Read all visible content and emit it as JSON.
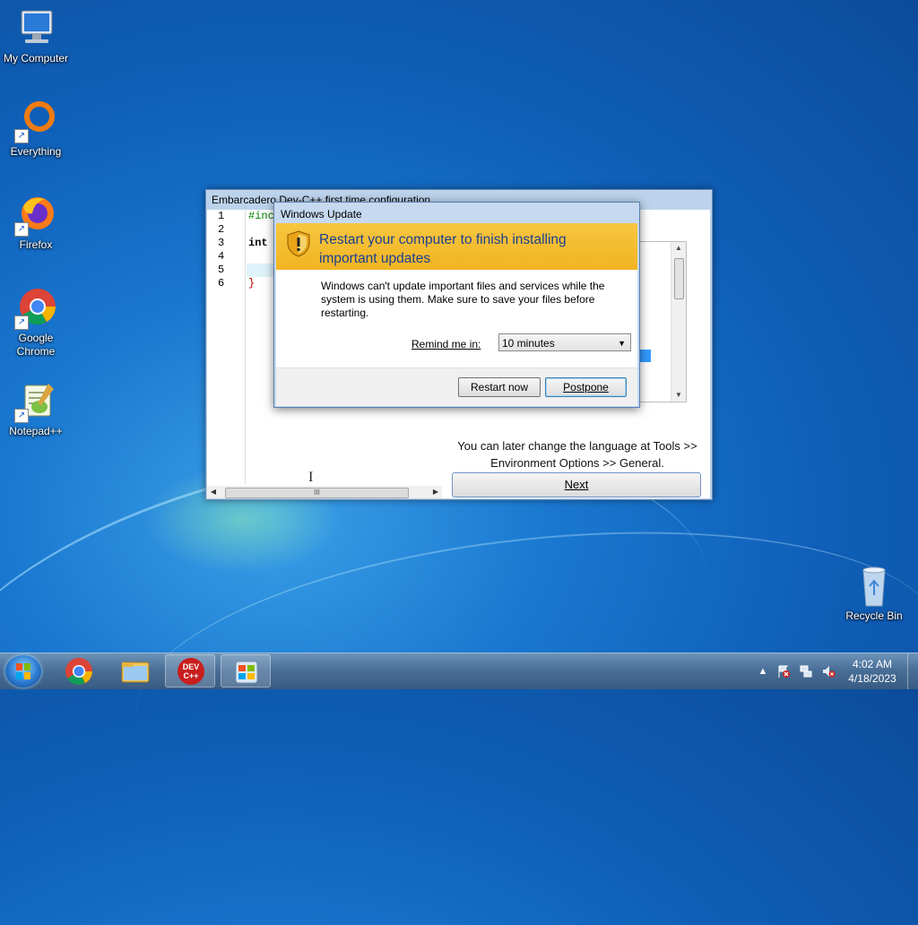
{
  "desktop": {
    "icons": [
      {
        "label": "My Computer",
        "icon": "computer-icon"
      },
      {
        "label": "Everything",
        "icon": "everything-icon"
      },
      {
        "label": "Firefox",
        "icon": "firefox-icon"
      },
      {
        "label": "Google Chrome",
        "icon": "chrome-icon"
      },
      {
        "label": "Notepad++",
        "icon": "notepadpp-icon"
      },
      {
        "label": "Recycle Bin",
        "icon": "recycle-bin-icon"
      }
    ]
  },
  "devcpp": {
    "title": "Embarcadero Dev-C++ first time configuration",
    "line_numbers": [
      "1",
      "2",
      "3",
      "4",
      "5",
      "6"
    ],
    "code_lines": [
      "#inc",
      "",
      "int m",
      "",
      "",
      "}"
    ],
    "scroll_grip": "III",
    "hint_text": "You can later change the language at Tools >> Environment Options >> General.",
    "next_label": "Next"
  },
  "windows_update": {
    "title": "Windows Update",
    "heading": "Restart your computer to finish installing important updates",
    "message": "Windows can't update important files and services while the system is using them. Make sure to save your files before restarting.",
    "remind_label": "Remind me in:",
    "remind_value": "10 minutes",
    "restart_label": "Restart now",
    "postpone_label": "Postpone"
  },
  "taskbar": {
    "pinned": [
      "start-orb",
      "chrome-icon",
      "explorer-icon",
      "devcpp-icon",
      "windows-update-icon"
    ],
    "devcpp_badge": "DEV C++",
    "clock_time": "4:02 AM",
    "clock_date": "4/18/2023",
    "tray_arrow": "▲"
  }
}
